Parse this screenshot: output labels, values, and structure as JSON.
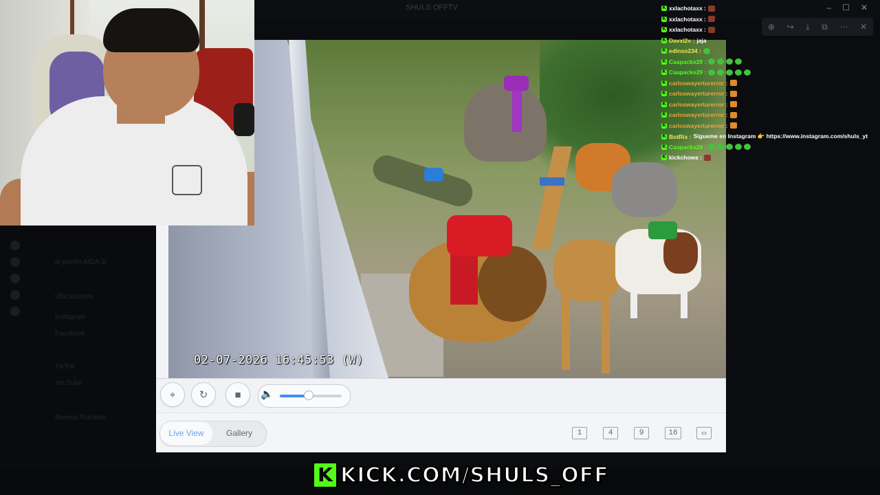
{
  "window": {
    "title": "SHULS OFFTV",
    "controls": [
      "–",
      "☐",
      "✕"
    ]
  },
  "toolbar_icons": [
    "zoom-icon",
    "share-icon",
    "download-icon",
    "popout-icon",
    "more-icon"
  ],
  "background_sidebar": {
    "items": [
      "el perrito AIDA 3l",
      "Ubicaciones",
      "Instagram",
      "Facebook",
      "TikTok",
      "YouTube",
      "Nuevos Rumbos"
    ]
  },
  "camera_app": {
    "timestamp": "02-07-2026  16:45:53  (W)",
    "volume_percent": 45,
    "tabs": {
      "live": "Live View",
      "gallery": "Gallery"
    },
    "grid_options": [
      "1",
      "4",
      "9",
      "16"
    ]
  },
  "chat": {
    "messages": [
      {
        "user": "xxlachotaxx",
        "color": "#ffffff",
        "text": "",
        "emote": "red"
      },
      {
        "user": "xxlachotaxx",
        "color": "#ffffff",
        "text": "",
        "emote": "red"
      },
      {
        "user": "xxlachotaxx",
        "color": "#ffffff",
        "text": "",
        "emote": "red"
      },
      {
        "user": "Davxl2v",
        "color": "#f3e84a",
        "text": "jaja",
        "emote": ""
      },
      {
        "user": "edinso234",
        "color": "#f3e84a",
        "text": "",
        "emote": "green"
      },
      {
        "user": "Caapacks29",
        "color": "#53fc18",
        "text": "",
        "emote": "green4"
      },
      {
        "user": "Caapacks29",
        "color": "#53fc18",
        "text": "",
        "emote": "green5"
      },
      {
        "user": "carloswayerturerror",
        "color": "#f1a23a",
        "text": "",
        "emote": "orange"
      },
      {
        "user": "carloswayerturerror",
        "color": "#f1a23a",
        "text": "",
        "emote": "orange"
      },
      {
        "user": "carloswayerturerror",
        "color": "#f1a23a",
        "text": "",
        "emote": "orange"
      },
      {
        "user": "carloswayerturerror",
        "color": "#f1a23a",
        "text": "",
        "emote": "orange"
      },
      {
        "user": "carloswayerturerror",
        "color": "#f1a23a",
        "text": "",
        "emote": "orange"
      },
      {
        "user": "BotRix",
        "color": "#f3e84a",
        "text": "Sígueme en Instagram 👉 https://www.instagram.com/shuls_yt",
        "emote": ""
      },
      {
        "user": "Caapacks29",
        "color": "#53fc18",
        "text": "",
        "emote": "green5"
      },
      {
        "user": "kickchows",
        "color": "#ffffff",
        "text": "",
        "emote": "red"
      }
    ]
  },
  "watermark": {
    "logo": "K",
    "text": "KICK.COM/SHULS_OFF",
    "accent": "#53fc18"
  }
}
